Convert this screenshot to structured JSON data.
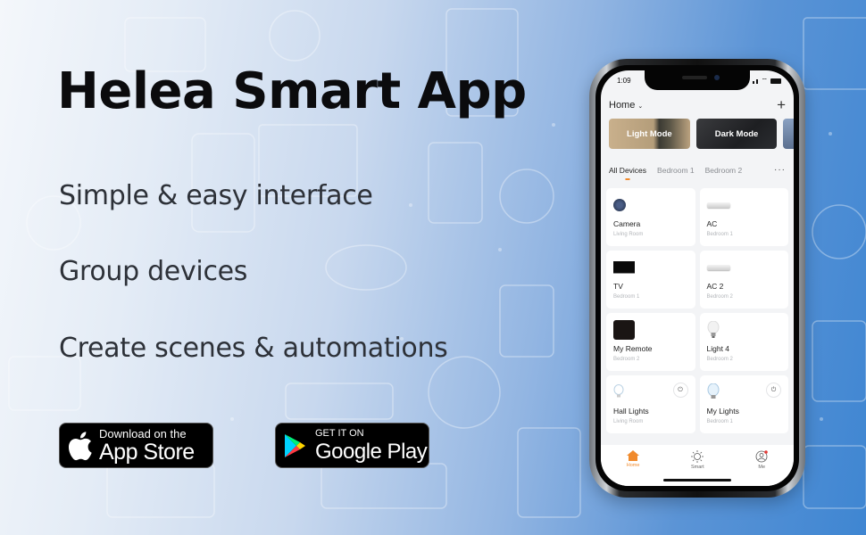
{
  "promo": {
    "title": "Helea Smart App",
    "features": [
      "Simple & easy interface",
      "Group devices",
      "Create scenes & automations"
    ]
  },
  "store_buttons": {
    "appstore": {
      "small": "Download on the",
      "big": "App Store",
      "icon": "apple-icon"
    },
    "googleplay": {
      "small": "GET IT ON",
      "big": "Google Play",
      "icon": "google-play-icon"
    }
  },
  "phone": {
    "status_time": "1:09",
    "home_label": "Home",
    "scenes": [
      {
        "label": "Light Mode"
      },
      {
        "label": "Dark Mode"
      }
    ],
    "tabs": [
      "All Devices",
      "Bedroom 1",
      "Bedroom 2"
    ],
    "more_label": "···",
    "devices": [
      {
        "name": "Camera",
        "room": "Living Room",
        "icon": "camera-icon",
        "power_button": false
      },
      {
        "name": "AC",
        "room": "Bedroom 1",
        "icon": "ac-unit-icon",
        "power_button": false
      },
      {
        "name": "TV",
        "room": "Bedroom 1",
        "icon": "tv-icon",
        "power_button": false
      },
      {
        "name": "AC 2",
        "room": "Bedroom 2",
        "icon": "ac-unit-icon",
        "power_button": false
      },
      {
        "name": "My Remote",
        "room": "Bedroom 2",
        "icon": "remote-icon",
        "power_button": false
      },
      {
        "name": "Light 4",
        "room": "Bedroom 2",
        "icon": "bulb-icon",
        "power_button": false
      },
      {
        "name": "Hall Lights",
        "room": "Living Room",
        "icon": "bulb-outline-icon",
        "power_button": true
      },
      {
        "name": "My Lights",
        "room": "Bedroom 1",
        "icon": "bulb-icon",
        "power_button": true
      }
    ],
    "bottom_nav": [
      {
        "label": "Home",
        "icon": "home-icon",
        "active": true
      },
      {
        "label": "Smart",
        "icon": "sun-icon",
        "active": false
      },
      {
        "label": "Me",
        "icon": "profile-icon",
        "active": false,
        "badge": true
      }
    ],
    "accent_color": "#f08a2c"
  }
}
